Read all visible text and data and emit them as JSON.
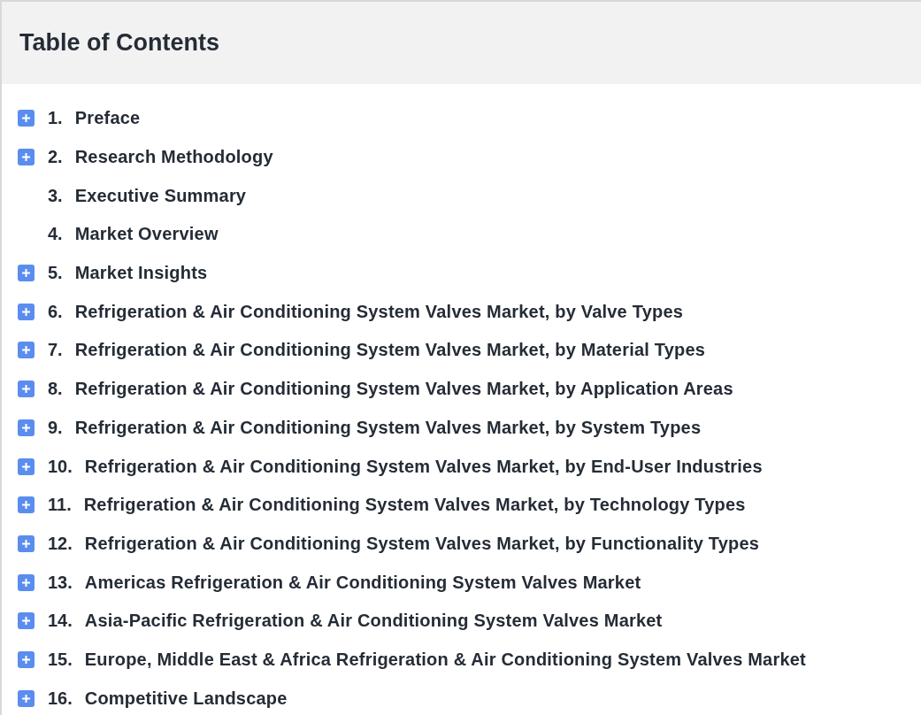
{
  "title": "Table of Contents",
  "items": [
    {
      "number": "1.",
      "label": "Preface",
      "kind": "expandable"
    },
    {
      "number": "2.",
      "label": "Research Methodology",
      "kind": "expandable"
    },
    {
      "number": "3.",
      "label": "Executive Summary",
      "kind": "plain"
    },
    {
      "number": "4.",
      "label": "Market Overview",
      "kind": "plain"
    },
    {
      "number": "5.",
      "label": "Market Insights",
      "kind": "expandable"
    },
    {
      "number": "6.",
      "label": "Refrigeration & Air Conditioning System Valves Market, by Valve Types",
      "kind": "expandable"
    },
    {
      "number": "7.",
      "label": "Refrigeration & Air Conditioning System Valves Market, by Material Types",
      "kind": "expandable"
    },
    {
      "number": "8.",
      "label": "Refrigeration & Air Conditioning System Valves Market, by Application Areas",
      "kind": "expandable"
    },
    {
      "number": "9.",
      "label": "Refrigeration & Air Conditioning System Valves Market, by System Types",
      "kind": "expandable"
    },
    {
      "number": "10.",
      "label": "Refrigeration & Air Conditioning System Valves Market, by End-User Industries",
      "kind": "expandable"
    },
    {
      "number": "11.",
      "label": "Refrigeration & Air Conditioning System Valves Market, by Technology Types",
      "kind": "expandable"
    },
    {
      "number": "12.",
      "label": "Refrigeration & Air Conditioning System Valves Market, by Functionality Types",
      "kind": "expandable"
    },
    {
      "number": "13.",
      "label": "Americas Refrigeration & Air Conditioning System Valves Market",
      "kind": "expandable"
    },
    {
      "number": "14.",
      "label": "Asia-Pacific Refrigeration & Air Conditioning System Valves Market",
      "kind": "expandable"
    },
    {
      "number": "15.",
      "label": "Europe, Middle East & Africa Refrigeration & Air Conditioning System Valves Market",
      "kind": "expandable"
    },
    {
      "number": "16.",
      "label": "Competitive Landscape",
      "kind": "expandable"
    }
  ]
}
